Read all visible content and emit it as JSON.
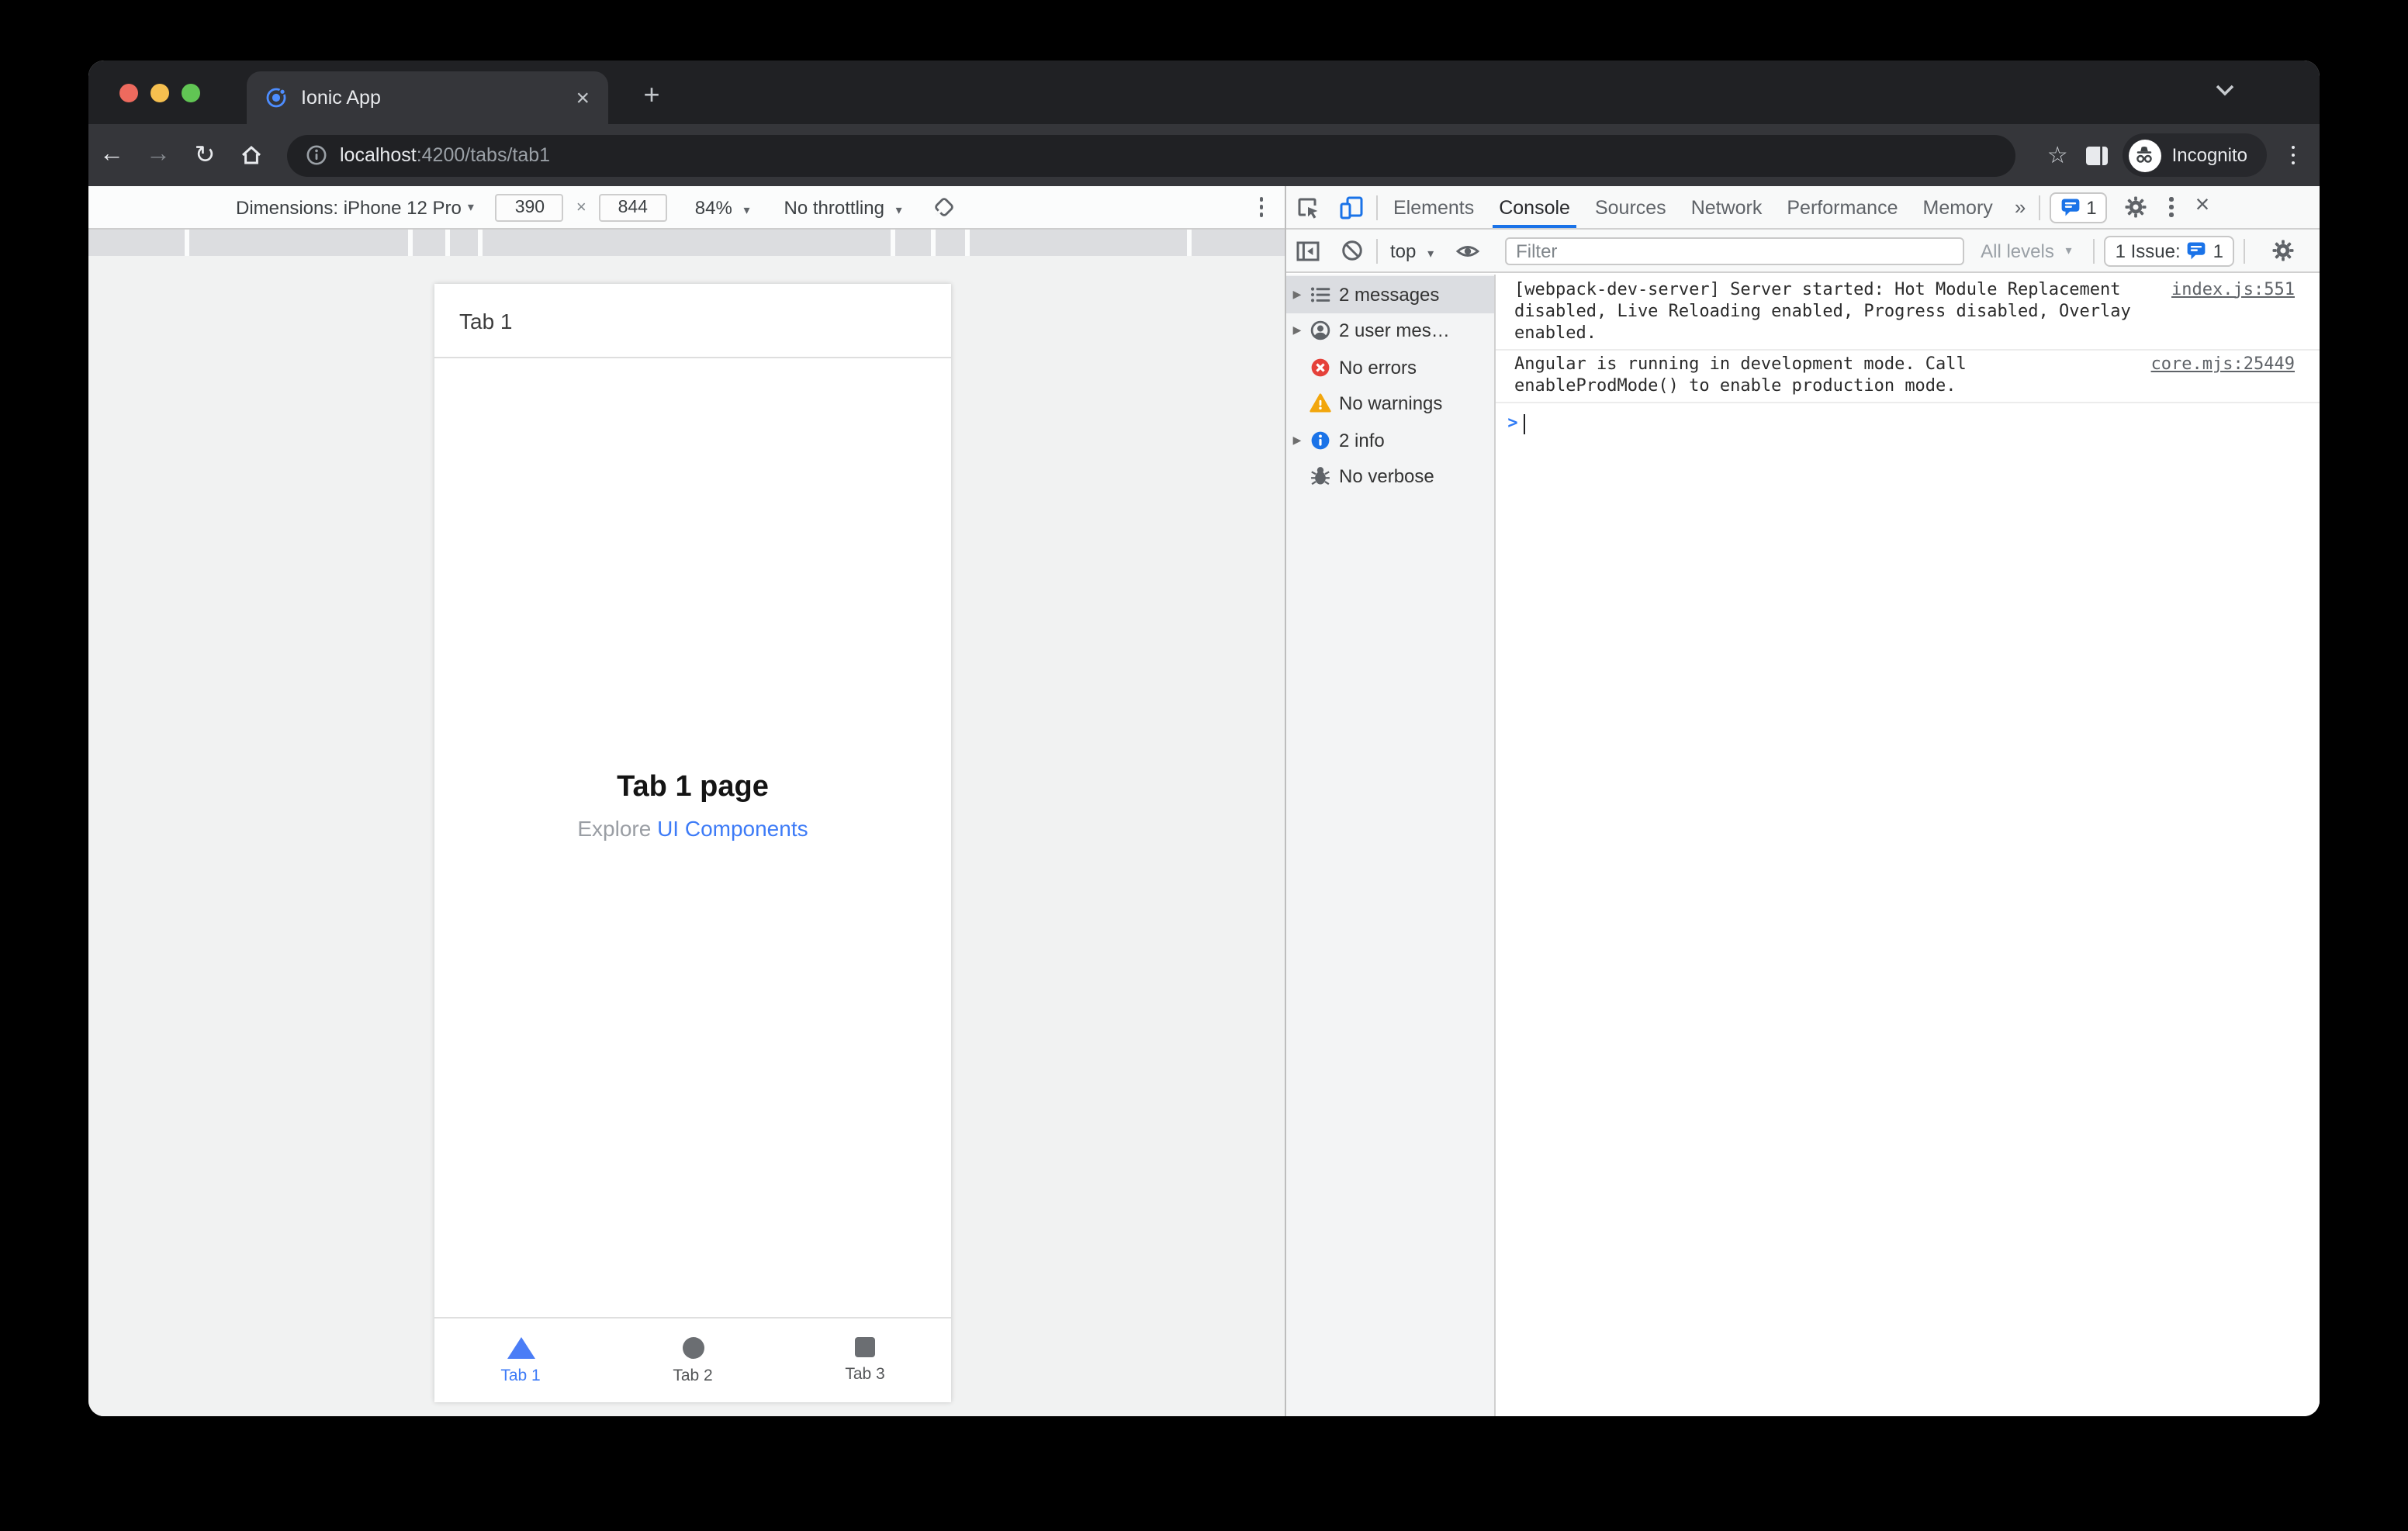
{
  "browser": {
    "tab_title": "Ionic App",
    "new_tab_glyph": "+",
    "close_glyph": "×",
    "url_host": "localhost",
    "url_rest": ":4200/tabs/tab1",
    "incognito_label": "Incognito",
    "icons": [
      "back-arrow",
      "forward-arrow",
      "reload",
      "home",
      "page-info",
      "bookmark-star",
      "side-panel",
      "incognito-badge",
      "menu-dots",
      "tabstrip-chevron"
    ]
  },
  "device_toolbar": {
    "dimensions_label": "Dimensions: iPhone 12 Pro",
    "width_value": "390",
    "times_glyph": "×",
    "height_value": "844",
    "zoom_value": "84%",
    "throttling_value": "No throttling",
    "caret_glyph": "▾"
  },
  "devtools": {
    "tabs": [
      {
        "label": "Elements"
      },
      {
        "label": "Console"
      },
      {
        "label": "Sources"
      },
      {
        "label": "Network"
      },
      {
        "label": "Performance"
      },
      {
        "label": "Memory"
      }
    ],
    "more_tabs_glyph": "»",
    "tab_issue_count": "1",
    "close_glyph": "×",
    "console_toolbar": {
      "context_label": "top",
      "filter_placeholder": "Filter",
      "levels_label": "All levels",
      "issues_label": "1 Issue:",
      "issues_count": "1",
      "caret_glyph": "▾"
    },
    "sidebar": [
      {
        "label": "2 messages",
        "icon": "list",
        "expandable": "▶",
        "selected": true
      },
      {
        "label": "2 user mes…",
        "icon": "user",
        "expandable": "▶",
        "selected": false
      },
      {
        "label": "No errors",
        "icon": "error",
        "expandable": "",
        "selected": false
      },
      {
        "label": "No warnings",
        "icon": "warning",
        "expandable": "",
        "selected": false
      },
      {
        "label": "2 info",
        "icon": "info",
        "expandable": "▶",
        "selected": false
      },
      {
        "label": "No verbose",
        "icon": "verbose",
        "expandable": "",
        "selected": false
      }
    ],
    "messages": [
      {
        "text": "[webpack-dev-server] Server started: Hot Module Replacement disabled, Live Reloading enabled, Progress disabled, Overlay enabled.",
        "source": "index.js:551"
      },
      {
        "text": "Angular is running in development mode. Call enableProdMode() to enable production mode.",
        "source": "core.mjs:25449"
      }
    ],
    "prompt_glyph": ">"
  },
  "app": {
    "header_title": "Tab 1",
    "page_title": "Tab 1 page",
    "subtitle_text": "Explore ",
    "subtitle_link": "UI Components",
    "tabs": [
      {
        "label": "Tab 1",
        "icon": "triangle",
        "active": true
      },
      {
        "label": "Tab 2",
        "icon": "ellipse",
        "active": false
      },
      {
        "label": "Tab 3",
        "icon": "square",
        "active": false
      }
    ]
  },
  "colors": {
    "accent_blue": "#1a73e8",
    "ionic_blue": "#3d7bf7",
    "chrome_dark": "#202124",
    "chrome_toolbar": "#35363a",
    "error_red": "#e5413a",
    "warning_yellow": "#f2a60d",
    "devtools_bg": "#f8f9f9"
  }
}
